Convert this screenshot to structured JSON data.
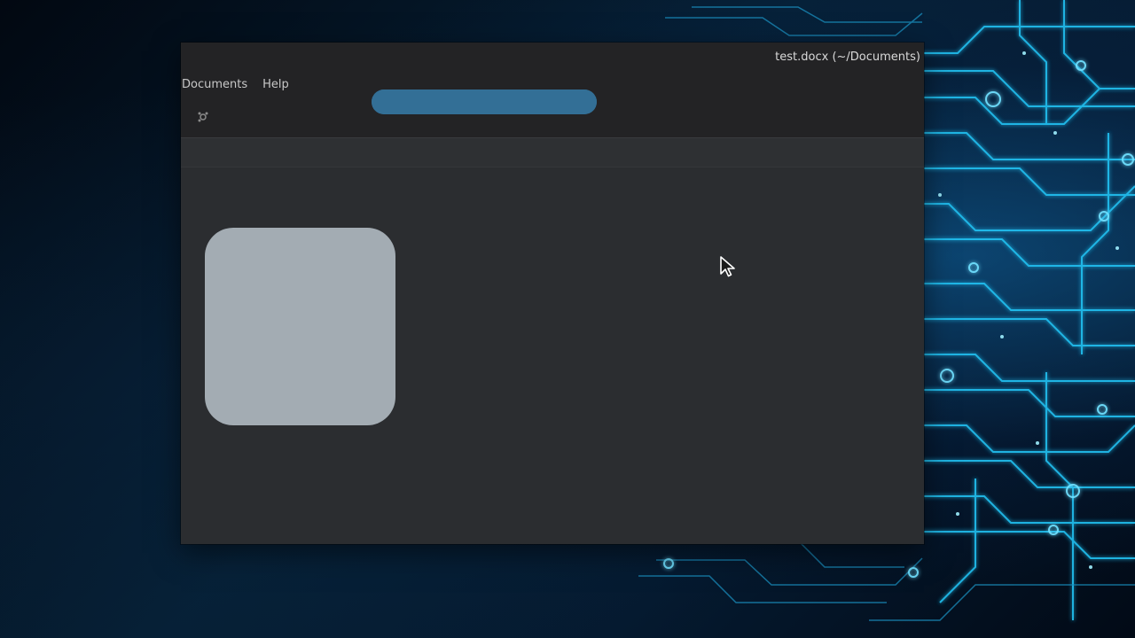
{
  "window": {
    "title": "test.docx (~/Documents)"
  },
  "menubar": {
    "items": [
      {
        "label": "Documents"
      },
      {
        "label": "Help"
      }
    ]
  },
  "toolbar": {
    "icon": "settings-icon"
  },
  "progress": {
    "fraction": 1.0
  },
  "colors": {
    "window_bg": "#2b2d30",
    "titlebar_bg": "#232325",
    "progress": "#2d6488",
    "splash": "#a3acb3",
    "wallpaper_accent": "#25c8ff"
  }
}
